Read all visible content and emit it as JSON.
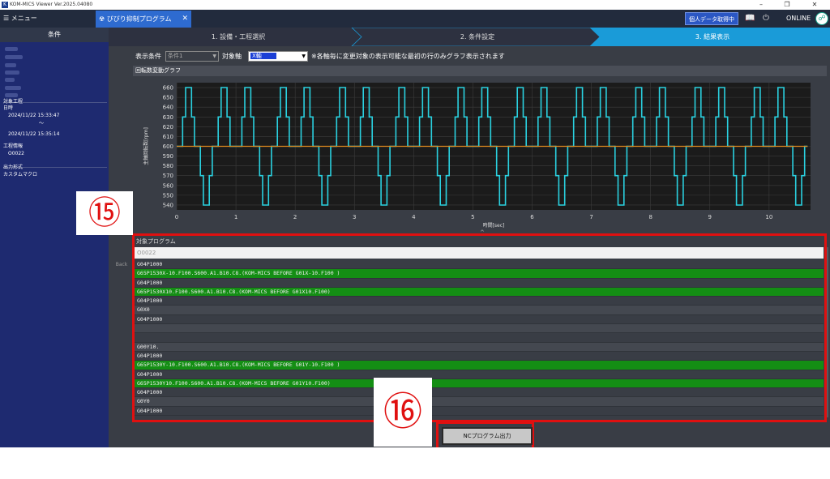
{
  "window": {
    "title": "KOM-MICS Viewer  Ver.2025.04080",
    "logo": "K",
    "minimize": "–",
    "restore": "❐",
    "close": "✕"
  },
  "topbar": {
    "menu_label": "☰ メニュー",
    "tab_label": "☢ びびり抑制プログラム",
    "tab_close": "✕",
    "personal_data_button": "個人データ取得中",
    "book_icon": "📖",
    "power_icon": "⏻",
    "status": "ONLINE",
    "status_icon": "☍"
  },
  "sidebar": {
    "header": "条件",
    "target_process_label": "対象工程",
    "datetime_label": "日時",
    "start_time": "2024/11/22 15:33:47",
    "tilde": "〜",
    "end_time": "2024/11/22 15:35:14",
    "process_info_label": "工程情報",
    "program_no": "O0022",
    "output_format_label": "出力形式",
    "output_format": "カスタムマクロ"
  },
  "steps": [
    "1. 設備・工程選択",
    "2. 条件設定",
    "3. 結果表示"
  ],
  "conditions": {
    "display_cond_label": "表示条件",
    "cond_value": "条件1",
    "axis_label": "対象軸",
    "axis_value": "X軸",
    "note": "※各軸毎に変更対象の表示可能な最初の行のみグラフ表示されます"
  },
  "chart_data": {
    "type": "line",
    "title": "回転数変動グラフ",
    "xlabel": "時間[sec]",
    "ylabel": "主軸回転数[rpm]",
    "xlim": [
      0,
      10.7
    ],
    "ylim": [
      535,
      665
    ],
    "xticks": [
      0,
      1,
      2,
      3,
      4,
      5,
      6,
      7,
      8,
      9,
      10
    ],
    "yticks": [
      540,
      550,
      560,
      570,
      580,
      590,
      600,
      610,
      620,
      630,
      640,
      650,
      660
    ],
    "grid": true,
    "series": [
      {
        "color": "#2ad1e0",
        "period_sec": 1.0,
        "x": [
          0,
          0.1,
          0.1,
          0.15,
          0.15,
          0.25,
          0.25,
          0.3,
          0.3,
          0.4,
          0.4,
          0.45,
          0.45,
          0.55,
          0.55,
          0.6,
          0.6,
          0.7,
          0.7,
          0.75,
          0.75,
          0.85,
          0.85,
          0.9,
          0.9,
          1.0
        ],
        "y": [
          600,
          600,
          630,
          630,
          660,
          660,
          630,
          630,
          600,
          600,
          570,
          570,
          540,
          540,
          570,
          570,
          600,
          600,
          630,
          630,
          660,
          660,
          630,
          630,
          600,
          600
        ],
        "end_x": 10.65
      },
      {
        "color": "#e08a1e",
        "x": [
          0,
          10.65
        ],
        "y": [
          600,
          600
        ]
      }
    ]
  },
  "program": {
    "header": "対象プログラム",
    "number": "O0022",
    "lines": [
      {
        "text": "G04P1000",
        "hl": false
      },
      {
        "text": "G65P1530X-10.F100.S600.A1.B10.C8.(KOM-MICS BEFORE G01X-10.F100 )",
        "hl": true
      },
      {
        "text": "G04P1000",
        "hl": false
      },
      {
        "text": "G65P1530X10.F100.S600.A1.B10.C8.(KOM-MICS BEFORE G01X10.F100)",
        "hl": true
      },
      {
        "text": "G04P1000",
        "hl": false
      },
      {
        "text": "G0X0",
        "hl": false
      },
      {
        "text": "G04P1000",
        "hl": false
      },
      {
        "text": "",
        "hl": false
      },
      {
        "text": "",
        "hl": false
      },
      {
        "text": "G00Y10.",
        "hl": false
      },
      {
        "text": "G04P1000",
        "hl": false
      },
      {
        "text": "G65P1530Y-10.F100.S600.A1.B10.C8.(KOM-MICS BEFORE G01Y-10.F100 )",
        "hl": true
      },
      {
        "text": "G04P1000",
        "hl": false
      },
      {
        "text": "G65P1530Y10.F100.S600.A1.B10.C8.(KOM-MICS BEFORE G01Y10.F100)",
        "hl": true
      },
      {
        "text": "G04P1000",
        "hl": false
      },
      {
        "text": "G0Y0",
        "hl": false
      },
      {
        "text": "G04P1000",
        "hl": false
      }
    ]
  },
  "back_button": "Back",
  "nc_output_button": "NCプログラム出力",
  "callouts": {
    "c15": "⑮",
    "c16": "⑯"
  },
  "colors": {
    "highlight": "#148e14",
    "callout_red": "#e01010",
    "accent_blue": "#1a9bd8"
  }
}
